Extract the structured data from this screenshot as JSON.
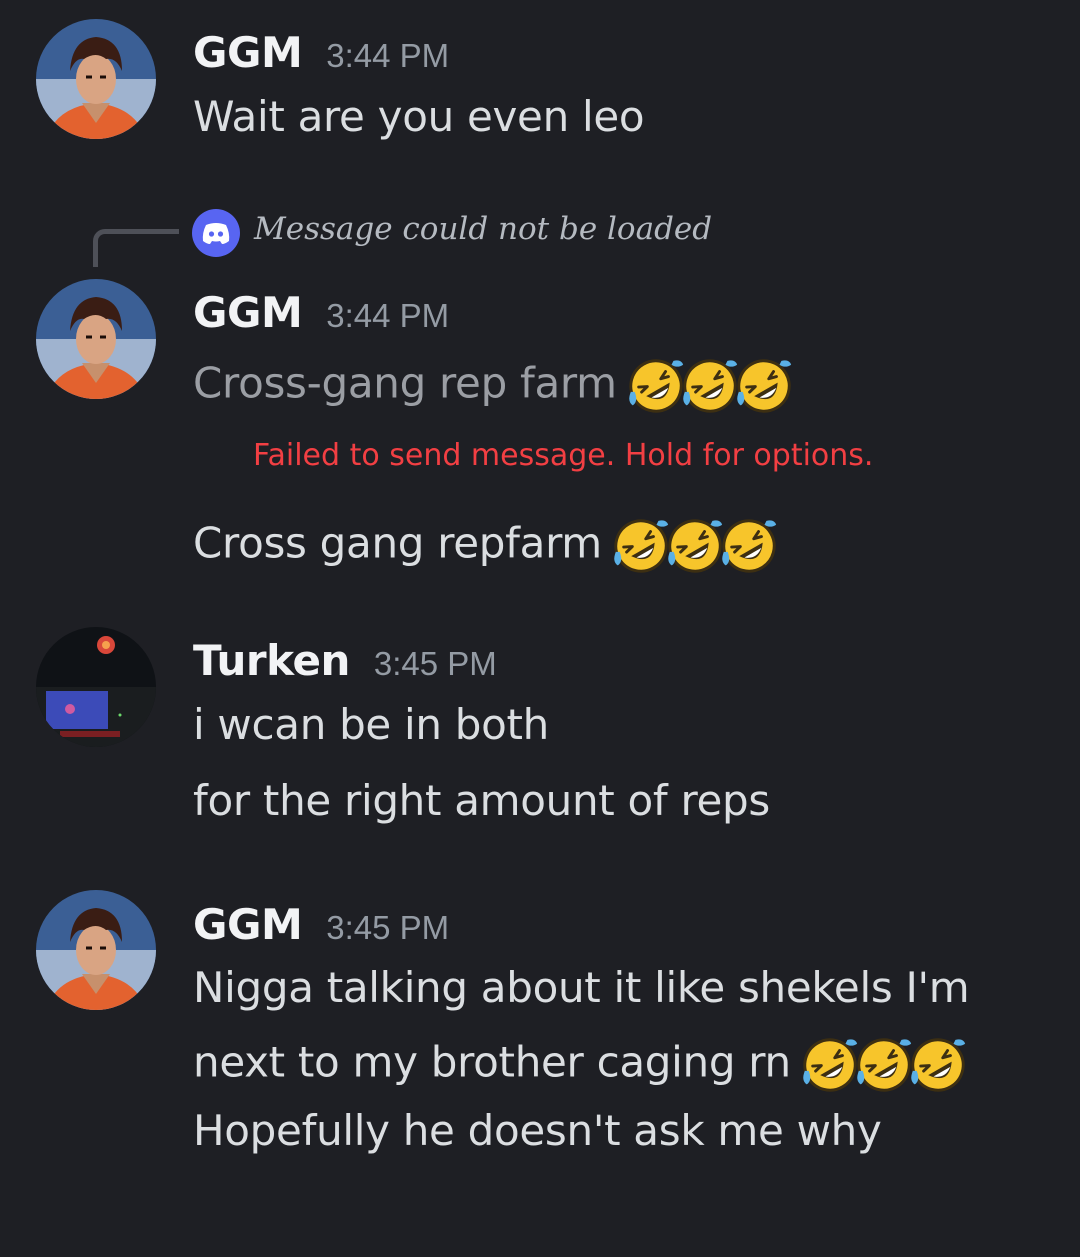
{
  "messages": [
    {
      "username": "GGM",
      "time": "3:44 PM",
      "lines": [
        "Wait are you even leo"
      ]
    },
    {
      "reply": {
        "text": "Message could not be loaded",
        "icon": "discord-logo-icon"
      },
      "username": "GGM",
      "time": "3:44 PM",
      "pending_line": "Cross-gang rep farm",
      "error": "Failed to send message. Hold for options.",
      "resent_line": "Cross gang repfarm"
    },
    {
      "username": "Turken",
      "time": "3:45 PM",
      "lines": [
        "i wcan be in both",
        "for the right amount of reps"
      ]
    },
    {
      "username": "GGM",
      "time": "3:45 PM",
      "lines": [
        "Nigga talking about it like shekels I'm",
        "next to my brother caging rn",
        "Hopefully he doesn't ask me why"
      ]
    }
  ],
  "emoji": "rolling-on-floor-laughing-emoji",
  "colors": {
    "background": "#1e1f24",
    "error": "#f23f43",
    "blurple": "#5865f2",
    "timestamp": "#949ba4"
  }
}
